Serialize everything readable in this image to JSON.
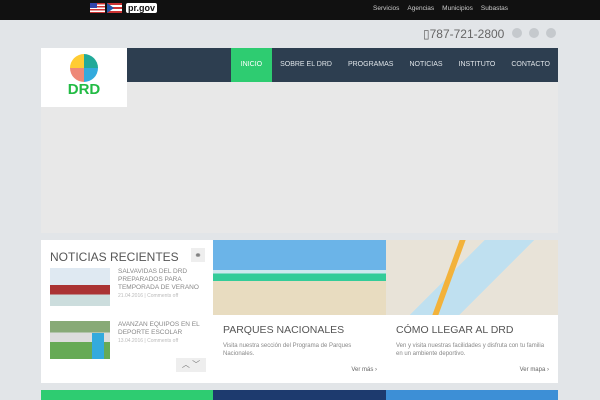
{
  "topbar": {
    "brand": "pr.gov",
    "links": [
      "Servicios",
      "Agencias",
      "Municipios",
      "Subastas"
    ]
  },
  "header": {
    "phone": "787-721-2800",
    "logo_text": "DRD"
  },
  "nav": [
    "INICIO",
    "SOBRE EL DRD",
    "PROGRAMAS",
    "NOTICIAS",
    "INSTITUTO",
    "CONTACTO"
  ],
  "news": {
    "title": "NOTICIAS RECIENTES",
    "items": [
      {
        "title": "SALVAVIDAS DEL DRD PREPARADOS PARA TEMPORADA DE VERANO",
        "meta": "21.04.2016 | Comments off"
      },
      {
        "title": "AVANZAN EQUIPOS EN EL DEPORTE ESCOLAR",
        "meta": "13.04.2016 | Comments off"
      }
    ]
  },
  "cards": [
    {
      "title": "PARQUES NACIONALES",
      "text": "Visita nuestra sección del Programa de Parques Nacionales.",
      "link": "Ver más ›"
    },
    {
      "title": "CÓMO LLEGAR AL DRD",
      "text": "Ven y visita nuestras facilidades y disfruta con tu familia en un ambiente deportivo.",
      "link": "Ver mapa ›"
    }
  ],
  "colors": {
    "nav": "#2d3e50",
    "accent": "#2ecc71"
  }
}
